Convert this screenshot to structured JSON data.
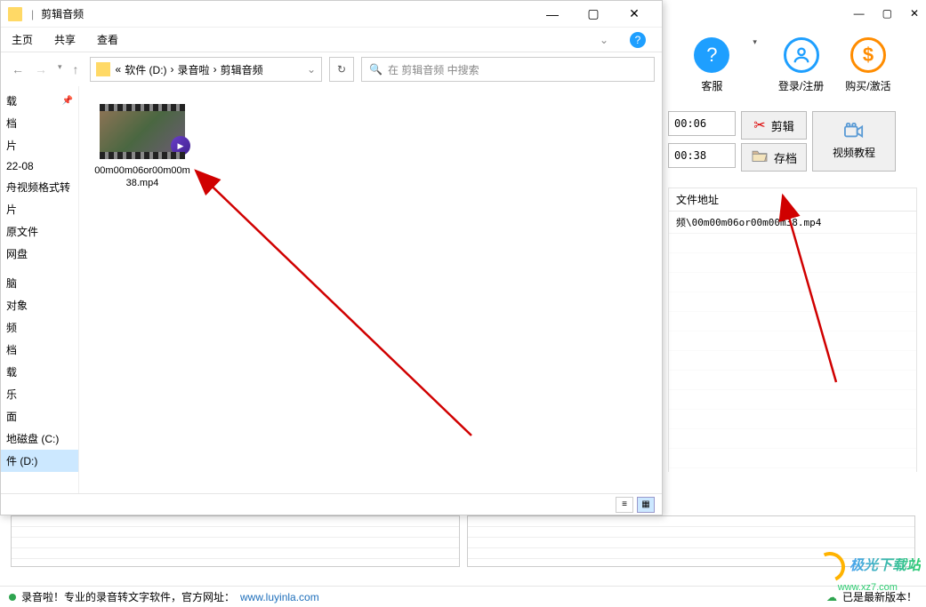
{
  "explorer": {
    "title": "剪辑音频",
    "tabs": {
      "home": "主页",
      "share": "共享",
      "view": "查看"
    },
    "breadcrumb": {
      "prefix": "«",
      "parts": [
        "软件 (D:)",
        "录音啦",
        "剪辑音频"
      ],
      "sep": "›"
    },
    "search_placeholder": "在 剪辑音频 中搜索",
    "sidebar": [
      "载",
      "档",
      "片",
      "22-08",
      "舟视频格式转",
      "片",
      "原文件",
      "网盘",
      "脑",
      "对象",
      "频",
      "档",
      "载",
      "乐",
      "面",
      "地磁盘 (C:)",
      "件 (D:)"
    ],
    "sidebar_selected": 16,
    "file": {
      "name": "00m00m06or00m00m38.mp4"
    },
    "status": {
      "item_count": ""
    }
  },
  "app": {
    "title_controls": {
      "minimize": "—",
      "maximize": "▢",
      "close": "✕"
    },
    "toolbar": {
      "help": "客服",
      "login": "登录/注册",
      "buy": "购买/激活"
    },
    "time1": "00:06",
    "time2": "00:38",
    "btn_edit": "剪辑",
    "btn_save": "存档",
    "btn_tutorial": "视频教程",
    "list_header": "文件地址",
    "list_row1": "频\\00m00m06or00m00m38.mp4"
  },
  "footer": {
    "text": "录音啦！专业的录音转文字软件，官方网址：",
    "url": "www.luyinla.com",
    "status": "已是最新版本！"
  },
  "watermark": {
    "name": "极光下载站",
    "url": "www.xz7.com"
  }
}
